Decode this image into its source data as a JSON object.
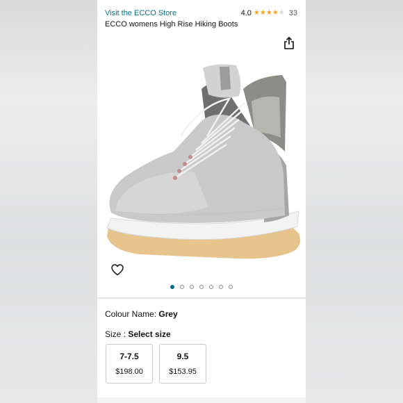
{
  "header": {
    "store_link": "Visit the ECCO Store",
    "rating_value": "4.0",
    "rating_stars": 4,
    "rating_count": "33",
    "product_title": "ECCO womens High Rise Hiking Boots"
  },
  "gallery": {
    "image_count": 7,
    "active_index": 0
  },
  "details": {
    "colour_label": "Colour Name: ",
    "colour_value": "Grey",
    "size_label": "Size : ",
    "size_value": "Select size",
    "sizes": [
      {
        "size": "7-7.5",
        "price": "$198.00"
      },
      {
        "size": "9.5",
        "price": "$153.95"
      }
    ]
  },
  "colors": {
    "link": "#007185",
    "star": "#f4a41d",
    "dot_active": "#007185"
  },
  "icons": [
    "share-icon",
    "heart-icon",
    "star-icon"
  ]
}
